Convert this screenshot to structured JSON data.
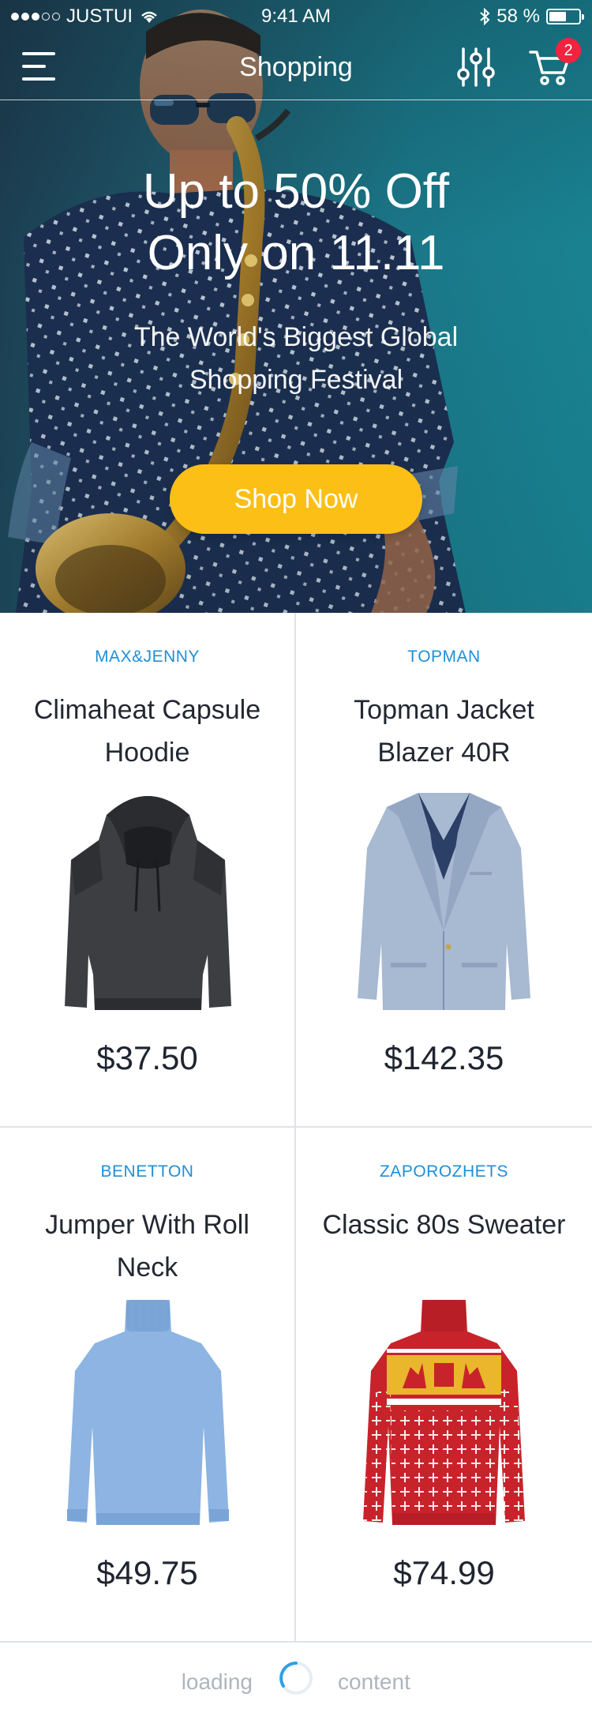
{
  "status_bar": {
    "carrier": "JUSTUI",
    "time": "9:41 AM",
    "battery": "58 %",
    "battery_level": 0.58
  },
  "nav": {
    "title": "Shopping",
    "menu_icon": "hamburger-menu-icon",
    "filter_icon": "sliders-filter-icon",
    "cart_icon": "shopping-cart-icon",
    "cart_count": "2"
  },
  "hero": {
    "headline_line1": "Up to 50% Off",
    "headline_line2": "Only on 11.11",
    "sub_line1": "The World's Biggest Global",
    "sub_line2": "Shopping Festival",
    "cta": "Shop Now",
    "colors": {
      "cta": "#fbbf16",
      "overlay": "#1a8c9b"
    }
  },
  "products": [
    {
      "brand": "MAX&JENNY",
      "name": "Climaheat Capsule Hoodie",
      "price": "$37.50",
      "image": "dark-grey-hoodie"
    },
    {
      "brand": "TOPMAN",
      "name": "Topman Jacket Blazer 40R",
      "price": "$142.35",
      "image": "light-blue-blazer"
    },
    {
      "brand": "BENETTON",
      "name": "Jumper With Roll Neck",
      "price": "$49.75",
      "image": "light-blue-turtleneck"
    },
    {
      "brand": "ZAPOROZHETS",
      "name": "Classic 80s Sweater",
      "price": "$74.99",
      "image": "red-christmas-sweater"
    }
  ],
  "loader": {
    "left_text": "loading",
    "right_text": "content"
  },
  "colors": {
    "brand_text": "#1f8fd6",
    "badge": "#f0243e",
    "divider": "#dfe3e8"
  }
}
